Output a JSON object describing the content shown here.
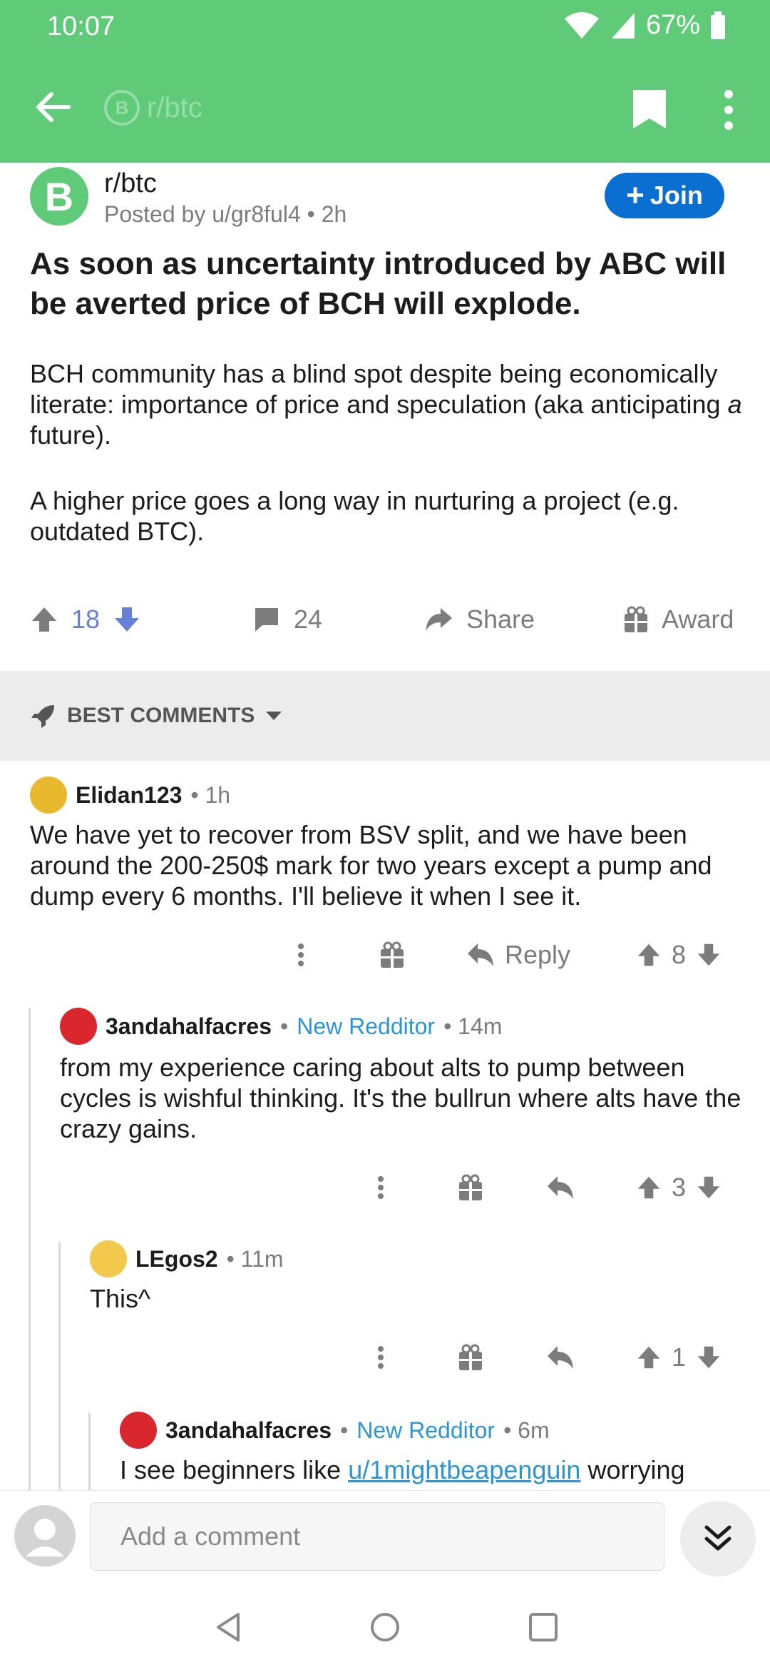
{
  "status": {
    "time": "10:07",
    "battery": "67%"
  },
  "appbar": {
    "subreddit": "r/btc",
    "coin_letter": "B"
  },
  "post": {
    "subreddit": "r/btc",
    "posted_by": "Posted by u/gr8ful4 • 2h",
    "join_label": "Join",
    "avatar_letter": "B",
    "title": "As soon as uncertainty introduced by ABC will be averted price of BCH will explode.",
    "body_1a": "BCH community has a blind spot despite being economically literate: importance of price and speculation (aka anticipating ",
    "body_1b": "a",
    "body_1c": " future).",
    "body_2": "A higher price goes a long way in nurturing a project (e.g. outdated BTC).",
    "votes": "18",
    "comments": "24",
    "share_label": "Share",
    "award_label": "Award"
  },
  "comments_header": {
    "label": "BEST COMMENTS"
  },
  "comments": [
    {
      "user": "Elidan123",
      "meta": "• 1h",
      "text": "We have yet to recover from BSV split, and we have been around the 200-250$ mark for two years except a pump and dump every 6 months. I'll believe it when I see it.",
      "reply_label": "Reply",
      "votes": "8",
      "avatar_color": "#e8b92c"
    },
    {
      "user": "3andahalfacres",
      "dot": "•",
      "flair": "New Redditor",
      "meta": "• 14m",
      "text": "from my experience caring about alts to pump between cycles is wishful thinking. It's the bullrun where alts have the crazy gains.",
      "votes": "3",
      "avatar_color": "#d9262f"
    },
    {
      "user": "LEgos2",
      "meta": "• 11m",
      "text": "This^",
      "votes": "1",
      "avatar_color": "#f2c94c"
    },
    {
      "user": "3andahalfacres",
      "dot": "•",
      "flair": "New Redditor",
      "meta": "• 6m",
      "text_a": "I see beginners like ",
      "text_link": "u/1mightbeapenguin",
      "text_b": " worrying",
      "avatar_color": "#d9262f"
    }
  ],
  "composer": {
    "placeholder": "Add a comment"
  },
  "colors": {
    "accent": "#5fcb79",
    "join": "#0a6fd0",
    "upvote_active": "#6680d8",
    "flair": "#2b95d6"
  }
}
